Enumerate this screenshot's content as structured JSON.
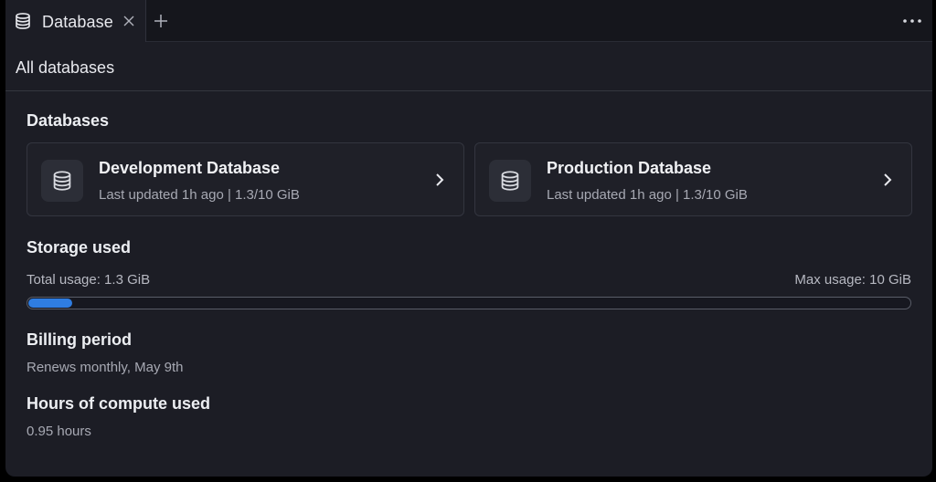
{
  "tab": {
    "label": "Database",
    "icon": "database-icon",
    "close_icon": "close-icon",
    "add_icon": "plus-icon",
    "more_icon": "more-horizontal-icon"
  },
  "header": {
    "title": "All databases"
  },
  "databases": {
    "title": "Databases",
    "items": [
      {
        "name": "Development Database",
        "meta": "Last updated 1h ago  |  1.3/10 GiB",
        "icon": "database-icon"
      },
      {
        "name": "Production Database",
        "meta": "Last updated 1h ago  |  1.3/10 GiB",
        "icon": "database-icon"
      }
    ]
  },
  "storage": {
    "title": "Storage used",
    "total_label": "Total usage: 1.3 GiB",
    "max_label": "Max usage: 10 GiB",
    "used_gib": 0.5,
    "max_gib": 10,
    "fill_color": "#2f7de1"
  },
  "billing": {
    "title": "Billing period",
    "text": "Renews monthly, May 9th"
  },
  "compute": {
    "title": "Hours of compute used",
    "text": "0.95 hours"
  }
}
